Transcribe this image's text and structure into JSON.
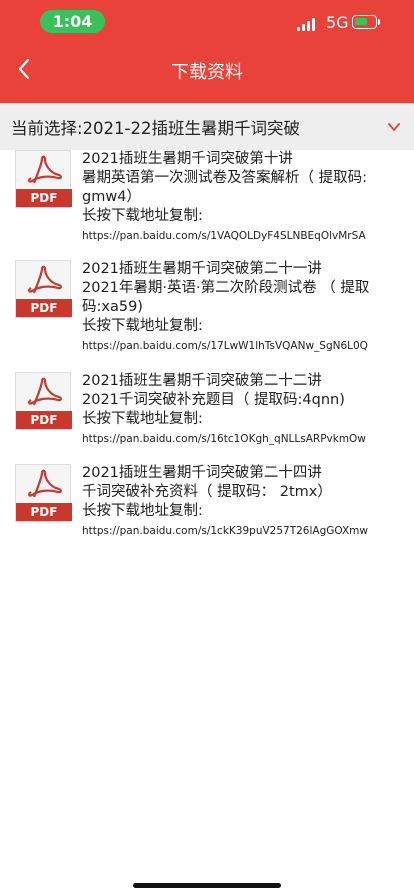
{
  "status_bar": {
    "time": "1:04",
    "network": "5G"
  },
  "header": {
    "title": "下载资料"
  },
  "selector": {
    "text": "当前选择:2021-22插班生暑期千词突破"
  },
  "items": [
    {
      "title": "2021插班生暑期千词突破第十讲",
      "desc": "暑期英语第一次测试卷及答案解析（ 提取码: gmw4）",
      "copy_label": "长按下载地址复制:",
      "url": "https://pan.baidu.com/s/1VAQOLDyF4SLNBEqOlvMrSA"
    },
    {
      "title": "2021插班生暑期千词突破第二十一讲",
      "desc": "2021年暑期·英语·第二次阶段测试卷 （ 提取码:xa59)",
      "copy_label": "长按下载地址复制:",
      "url": "https://pan.baidu.com/s/17LwW1lhTsVQANw_SgN6L0Q"
    },
    {
      "title": "2021插班生暑期千词突破第二十二讲",
      "desc": "2021千词突破补充题目（ 提取码:4qnn)",
      "copy_label": "长按下载地址复制:",
      "url": "https://pan.baidu.com/s/16tc1OKgh_qNLLsARPvkmOw"
    },
    {
      "title": "2021插班生暑期千词突破第二十四讲",
      "desc": "千词突破补充资料（ 提取码： 2tmx）",
      "copy_label": "长按下载地址复制:",
      "url": "https://pan.baidu.com/s/1ckK39puV257T26lAgGOXmw"
    }
  ],
  "pdf_label": "PDF",
  "colors": {
    "brand_red": "#e8423a",
    "pdf_red": "#c9382f",
    "status_green": "#3ac15c"
  }
}
